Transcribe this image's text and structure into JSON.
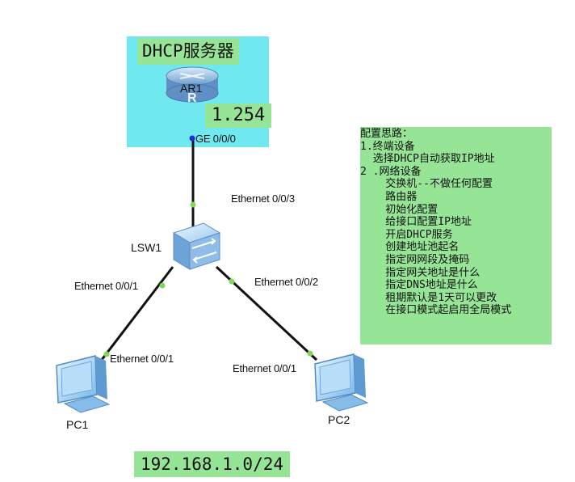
{
  "server_area": {
    "title": "DHCP服务器",
    "ip_suffix": "1.254",
    "color": "#6fe8f0"
  },
  "devices": {
    "router": {
      "name": "AR1",
      "icon": "router-icon",
      "port": "GE 0/0/0"
    },
    "switch": {
      "name": "LSW1",
      "icon": "switch-icon",
      "ports": {
        "uplink": "Ethernet 0/0/3",
        "to_pc1": "Ethernet 0/0/1",
        "to_pc2": "Ethernet 0/0/2"
      }
    },
    "pc1": {
      "name": "PC1",
      "icon": "pc-icon",
      "port": "Ethernet 0/0/1"
    },
    "pc2": {
      "name": "PC2",
      "icon": "pc-icon",
      "port": "Ethernet 0/0/1"
    }
  },
  "network_label": "192.168.1.0/24",
  "notes": {
    "lines": [
      "配置思路：",
      "1.终端设备",
      "  选择DHCP自动获取IP地址",
      "2 .网络设备",
      "    交换机--不做任何配置",
      "    路由器",
      "    初始化配置",
      "    给接口配置IP地址",
      "    开启DHCP服务",
      "    创建地址池起名",
      "    指定网网段及掩码",
      "    指定网关地址是什么",
      "    指定DNS地址是什么",
      "    租期默认是1天可以更改",
      "    在接口模式起启用全局模式"
    ]
  },
  "colors": {
    "highlight_green": "#96e496",
    "link": "#111111",
    "port_dot": "#7ed957",
    "router_port_dot": "#1f2dd6",
    "device_blue": "#7fb8e8"
  }
}
